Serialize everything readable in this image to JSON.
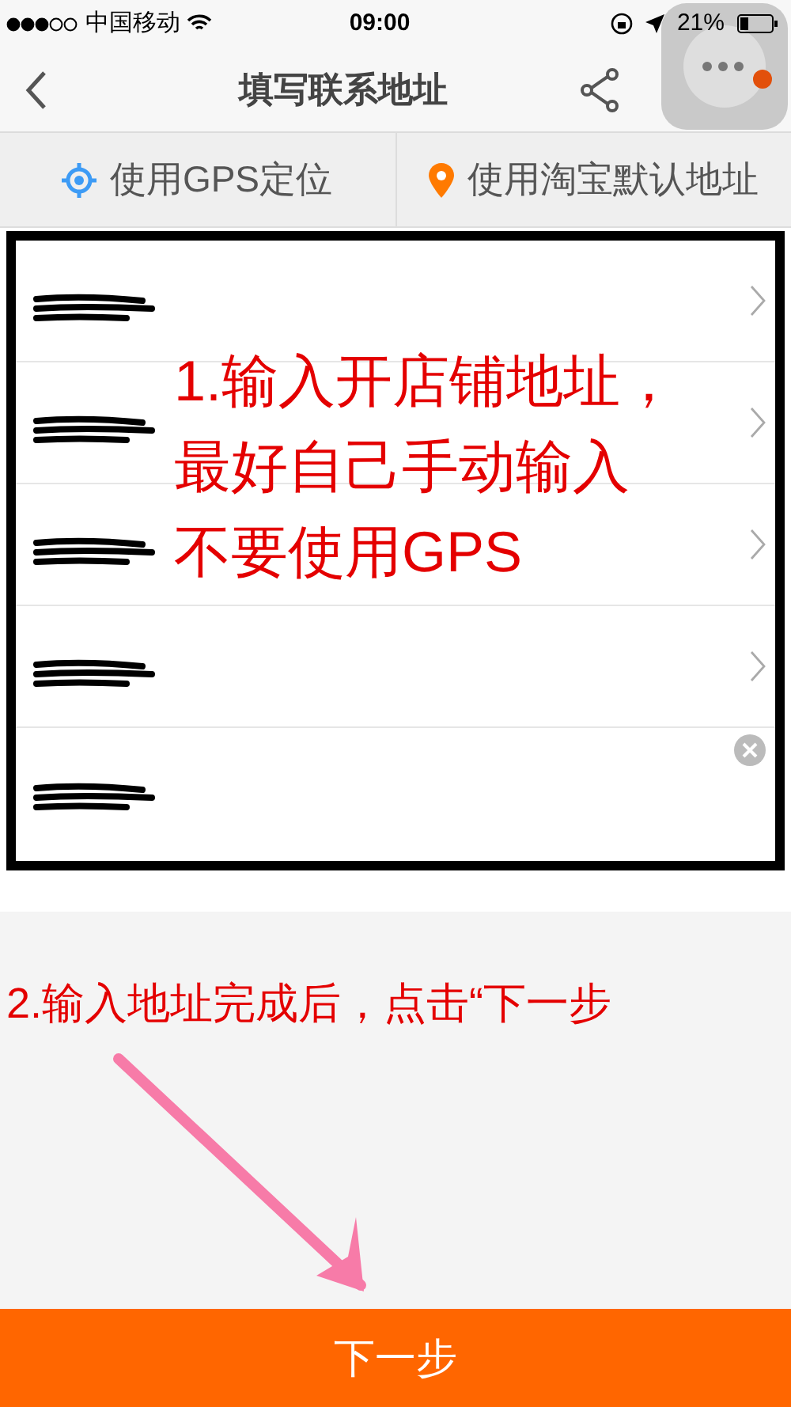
{
  "status_bar": {
    "carrier": "中国移动",
    "time": "09:00",
    "battery": "21%"
  },
  "nav": {
    "title": "填写联系地址"
  },
  "location_options": [
    {
      "kind": "gps",
      "label": "使用GPS定位"
    },
    {
      "kind": "default",
      "label": "使用淘宝默认地址"
    }
  ],
  "address_fields": [
    {
      "kind": "select"
    },
    {
      "kind": "select"
    },
    {
      "kind": "select"
    },
    {
      "kind": "select"
    },
    {
      "kind": "input"
    }
  ],
  "annotation_1": [
    "1.输入开店铺地址，",
    "最好自己手动输入",
    "不要使用GPS"
  ],
  "annotation_2": "2.输入地址完成后，点击“下一步",
  "next_button": "下一步"
}
